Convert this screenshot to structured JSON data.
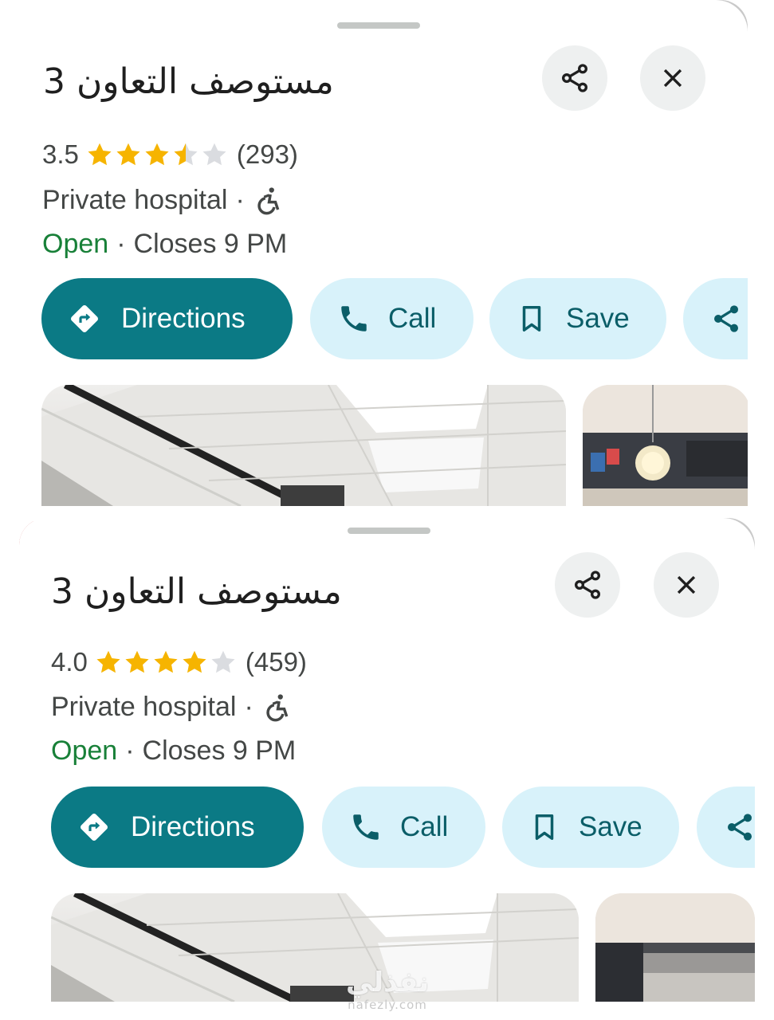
{
  "panels": [
    {
      "title": "مستوصف التعاون 3",
      "rating": "3.5",
      "rating_value": 3.5,
      "reviews": "(293)",
      "category": "Private hospital",
      "dot": "·",
      "status_open": "Open",
      "status_hours": "Closes 9 PM",
      "actions": {
        "directions": "Directions",
        "call": "Call",
        "save": "Save"
      }
    },
    {
      "title": "مستوصف التعاون 3",
      "rating": "4.0",
      "rating_value": 4.0,
      "reviews": "(459)",
      "category": "Private hospital",
      "dot": "·",
      "status_open": "Open",
      "status_hours": "Closes 9 PM",
      "actions": {
        "directions": "Directions",
        "call": "Call",
        "save": "Save"
      }
    }
  ],
  "icons": {
    "share": "share-icon",
    "close": "close-icon",
    "wheelchair": "wheelchair-accessible-icon",
    "directions": "directions-icon",
    "call": "phone-icon",
    "save": "bookmark-icon"
  },
  "colors": {
    "accent": "#0b7a85",
    "chip_tonal": "#d8f2fa",
    "open": "#188038",
    "star": "#f6b400",
    "star_empty": "#dadce0"
  },
  "watermark": {
    "main": "نفذلي",
    "sub": "nafezly.com"
  }
}
